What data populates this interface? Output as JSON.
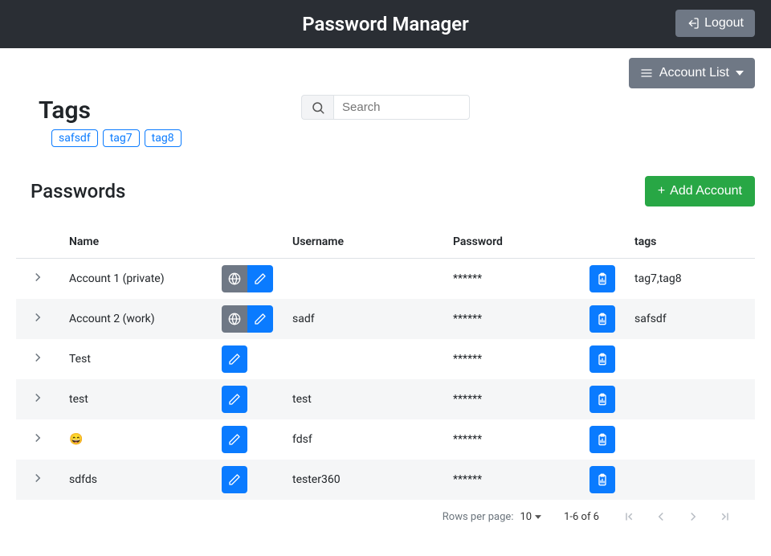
{
  "header": {
    "title": "Password Manager",
    "logout_label": "Logout",
    "account_list_label": "Account List"
  },
  "tags_section": {
    "heading": "Tags",
    "tags": [
      "safsdf",
      "tag7",
      "tag8"
    ]
  },
  "search": {
    "placeholder": "Search"
  },
  "passwords_section": {
    "heading": "Passwords",
    "add_label": "Add Account"
  },
  "table": {
    "columns": {
      "name": "Name",
      "username": "Username",
      "password": "Password",
      "tags": "tags"
    },
    "rows": [
      {
        "name": "Account 1 (private)",
        "has_url": true,
        "username": "",
        "password": "******",
        "tags": "tag7,tag8"
      },
      {
        "name": "Account 2 (work)",
        "has_url": true,
        "username": "sadf",
        "password": "******",
        "tags": "safsdf"
      },
      {
        "name": "Test",
        "has_url": false,
        "username": "",
        "password": "******",
        "tags": ""
      },
      {
        "name": "test",
        "has_url": false,
        "username": "test",
        "password": "******",
        "tags": ""
      },
      {
        "name": "😄",
        "has_url": false,
        "username": "fdsf",
        "password": "******",
        "tags": ""
      },
      {
        "name": "sdfds",
        "has_url": false,
        "username": "tester360",
        "password": "******",
        "tags": ""
      }
    ]
  },
  "pagination": {
    "rows_per_page_label": "Rows per page:",
    "rows_per_page_value": "10",
    "range_label": "1-6 of 6"
  },
  "icons": {
    "logout": "logout-icon",
    "menu": "menu-icon",
    "caret": "caret-down-icon",
    "search": "search-icon",
    "plus": "plus-icon",
    "chevron_right": "chevron-right-icon",
    "globe": "globe-icon",
    "pencil": "pencil-icon",
    "clipboard_chart": "clipboard-chart-icon"
  }
}
